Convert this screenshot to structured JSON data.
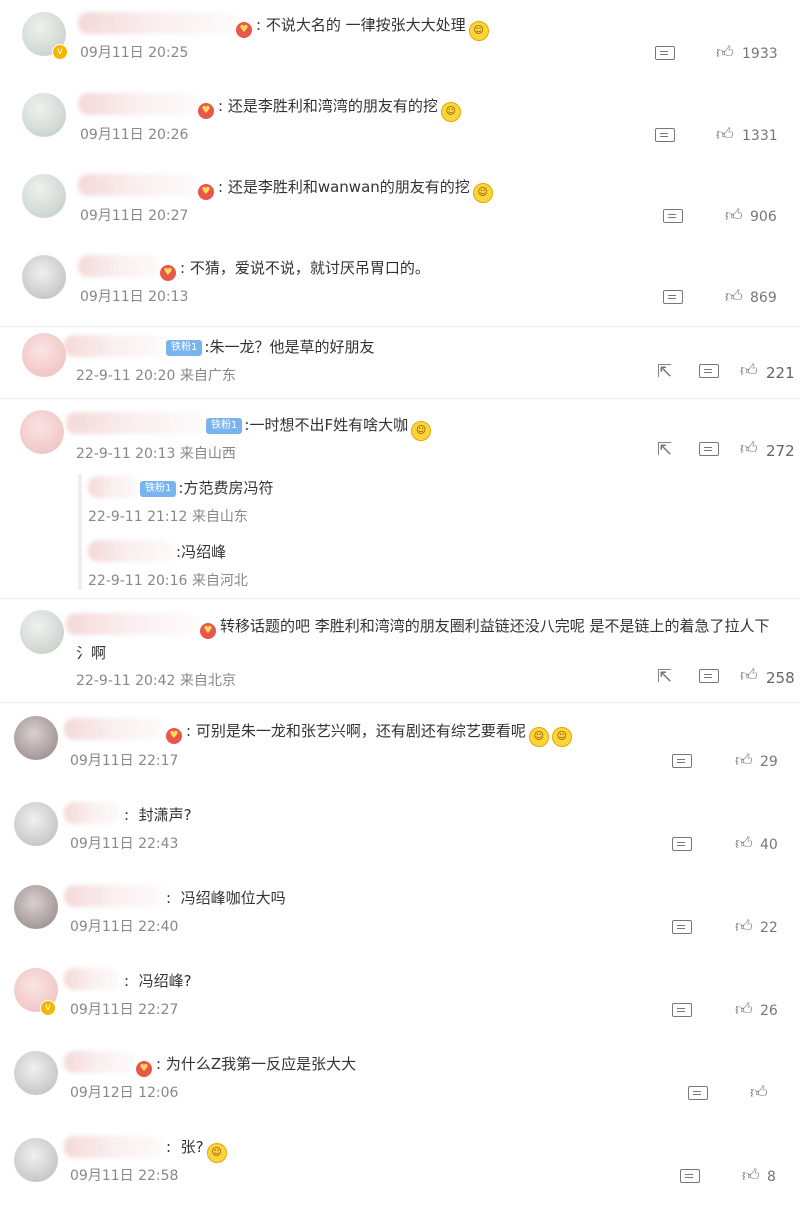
{
  "comments": [
    {
      "text": "不说大名的 一律按张大大处理",
      "time": "09月11日 20:25",
      "likes": "1933"
    },
    {
      "text": "还是李胜利和湾湾的朋友有的挖",
      "time": "09月11日 20:26",
      "likes": "1331"
    },
    {
      "text": "还是李胜利和wanwan的朋友有的挖",
      "time": "09月11日 20:27",
      "likes": "906"
    },
    {
      "text": "不猜，爱说不说，就讨厌吊胃口的。",
      "time": "09月11日 20:13",
      "likes": "869"
    },
    {
      "text": "朱一龙？他是草的好朋友",
      "time": "22-9-11 20:20 来自广东",
      "likes": "221"
    },
    {
      "text": "一时想不出F姓有啥大咖",
      "time": "22-9-11 20:13 来自山西",
      "likes": "272"
    },
    {
      "text": "方范费房冯符",
      "time": "22-9-11 21:12 来自山东"
    },
    {
      "text": "冯绍峰",
      "time": "22-9-11 20:16 来自河北"
    },
    {
      "text": "转移话题的吧 李胜利和湾湾的朋友圈利益链还没八完呢 是不是链上的着急了拉人下",
      "text2": "氵啊",
      "time": "22-9-11 20:42 来自北京",
      "likes": "258"
    },
    {
      "text": "可别是朱一龙和张艺兴啊，还有剧还有综艺要看呢",
      "time": "09月11日 22:17",
      "likes": "29"
    },
    {
      "text": "封潇声?",
      "time": "09月11日 22:43",
      "likes": "40"
    },
    {
      "text": "冯绍峰咖位大吗",
      "time": "09月11日 22:40",
      "likes": "22"
    },
    {
      "text": "冯绍峰?",
      "time": "09月11日 22:27",
      "likes": "26"
    },
    {
      "text": "为什么Z我第一反应是张大大",
      "time": "09月12日 12:06",
      "likes": ""
    },
    {
      "text": "张?",
      "time": "09月11日 22:58",
      "likes": "8"
    }
  ],
  "fan_badge": "铁粉1",
  "icons": {
    "reply": "reply-box-icon",
    "like": "thumb-up-icon",
    "share": "share-icon",
    "heart": "heart-badge-icon",
    "emoji": "emoji-icon"
  }
}
